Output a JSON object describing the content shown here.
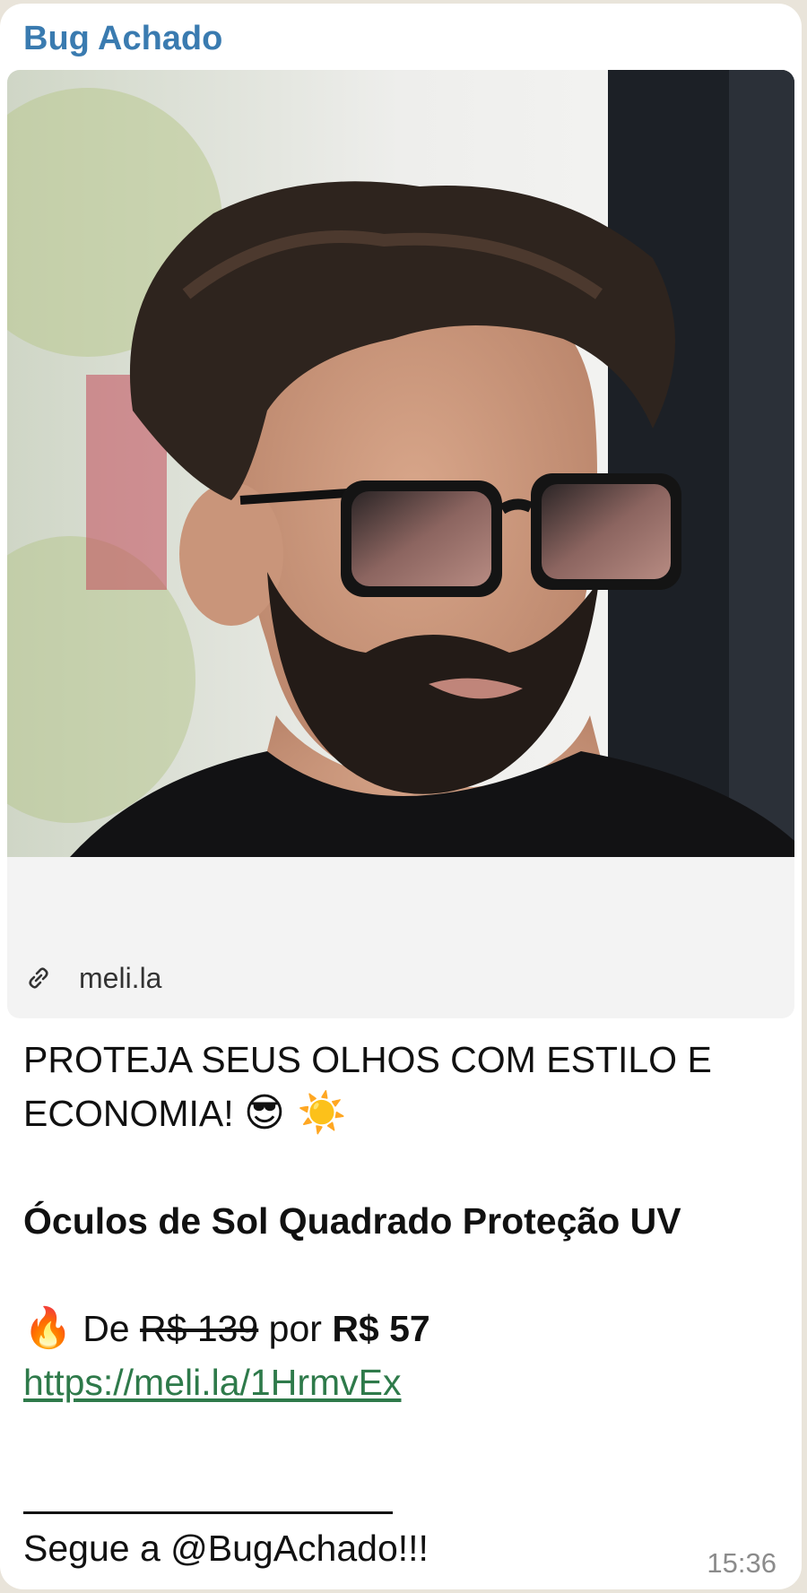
{
  "message": {
    "sender": "Bug Achado",
    "preview": {
      "domain": "meli.la",
      "link_icon": "link-icon"
    },
    "headline_line1": "PROTEJA SEUS OLHOS COM ESTILO E",
    "headline_line2": "ECONOMIA!",
    "headline_emojis": "😎 ☀️",
    "product_title": "Óculos de Sol Quadrado Proteção UV",
    "price": {
      "emoji": "🔥",
      "from_label": "De",
      "old_price": "R$ 139",
      "by_label": "por",
      "new_price": "R$ 57"
    },
    "url": "https://meli.la/1HrmvEx",
    "follow_text": "Segue a @BugAchado!!!",
    "time": "15:36"
  }
}
